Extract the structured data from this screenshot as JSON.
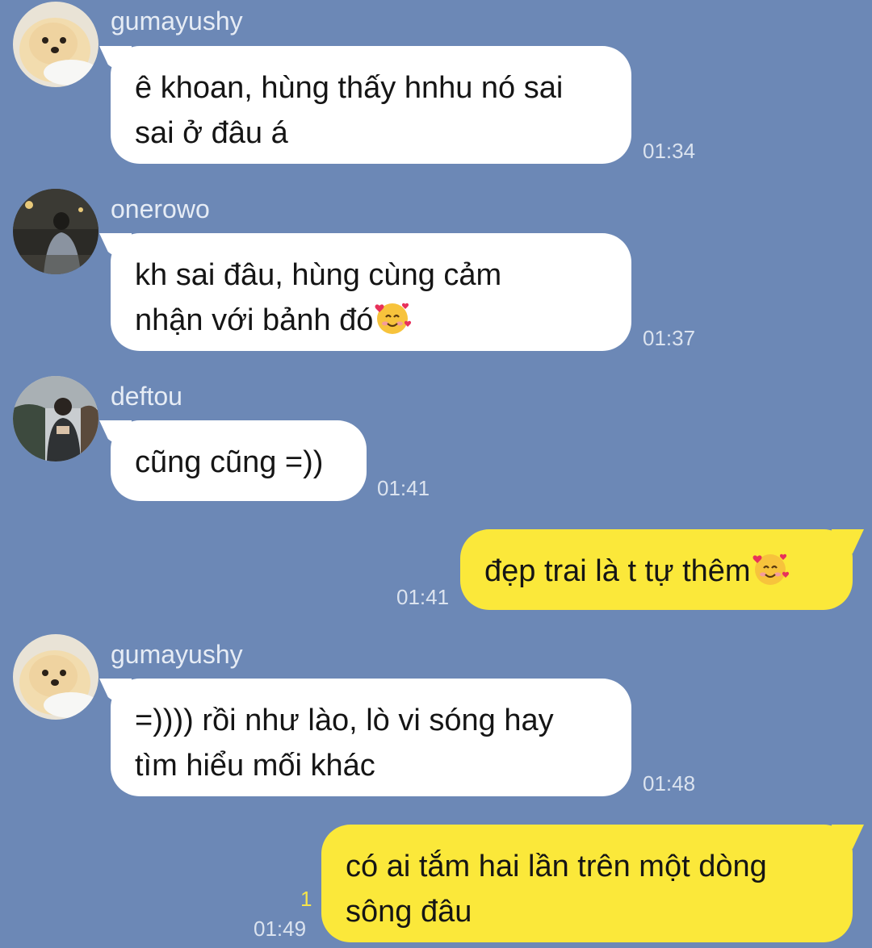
{
  "messages": [
    {
      "sender": "gumayushy",
      "text_lines": [
        "ê khoan, hùng thấy hnhu nó sai",
        "sai ở đâu á"
      ],
      "time": "01:34",
      "avatar": "pomeranian-dog-avatar"
    },
    {
      "sender": "onerowo",
      "text_lines": [
        "kh sai đâu, hùng cùng cảm",
        "nhận với bảnh đó"
      ],
      "time": "01:37",
      "emoji": "smiling-face-with-hearts",
      "avatar": "night-street-person-avatar"
    },
    {
      "sender": "deftou",
      "text_lines": [
        "cũng cũng =))"
      ],
      "time": "01:41",
      "avatar": "outdoor-person-avatar"
    },
    {
      "sender": "me",
      "text_lines": [
        "đẹp trai là t tự thêm"
      ],
      "time": "01:41",
      "emoji": "smiling-face-with-hearts"
    },
    {
      "sender": "gumayushy",
      "text_lines": [
        "=)))) rồi như lào, lò vi sóng hay",
        "tìm hiểu mối khác"
      ],
      "time": "01:48",
      "avatar": "pomeranian-dog-avatar"
    },
    {
      "sender": "me",
      "text_lines": [
        "có ai tắm hai lần trên một dòng",
        "sông đâu"
      ],
      "time": "01:49",
      "read_count": "1"
    }
  ],
  "colors": {
    "background": "#6c88b6",
    "incoming_bubble": "#ffffff",
    "outgoing_bubble": "#fbe83a",
    "read_indicator": "#f6e44a"
  }
}
